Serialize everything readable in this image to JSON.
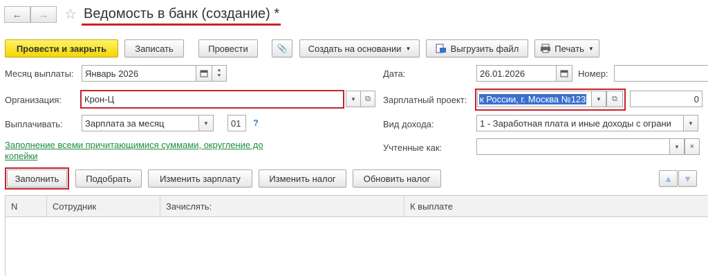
{
  "header": {
    "back_icon": "←",
    "forward_icon": "→",
    "star_icon": "☆",
    "title": "Ведомость в банк (создание) *"
  },
  "toolbar": {
    "post_close": "Провести и закрыть",
    "save": "Записать",
    "post": "Провести",
    "attach_icon": "📎",
    "create_based": "Создать на основании",
    "export_file": "Выгрузить файл",
    "print": "Печать"
  },
  "form": {
    "month_label": "Месяц выплаты:",
    "month_value": "Январь 2026",
    "date_label": "Дата:",
    "date_value": "26.01.2026",
    "number_label": "Номер:",
    "number_value": "",
    "org_label": "Организация:",
    "org_value": "Крон-Ц",
    "salary_project_label": "Зарплатный проект:",
    "salary_project_value": "к России, г. Москва №123",
    "salary_amount": "0",
    "pay_label": "Выплачивать:",
    "pay_value": "Зарплата за месяц",
    "pay_day": "01",
    "help": "?",
    "income_label": "Вид дохода:",
    "income_value": "1 - Заработная плата и иные доходы с ограни",
    "accounted_label": "Учтенные как:",
    "accounted_value": "",
    "fill_link": "Заполнение всеми причитающимися суммами, округление до копейки"
  },
  "table_toolbar": {
    "fill": "Заполнить",
    "pick": "Подобрать",
    "change_salary": "Изменить зарплату",
    "change_tax": "Изменить налог",
    "update_tax": "Обновить налог"
  },
  "table": {
    "columns": [
      "N",
      "Сотрудник",
      "Зачислять:",
      "К выплате"
    ]
  },
  "colors": {
    "accent_yellow": "#f2d600",
    "highlight_red": "#c8212b",
    "link_green": "#1c8c3c",
    "selection_blue": "#3a6fd0"
  }
}
